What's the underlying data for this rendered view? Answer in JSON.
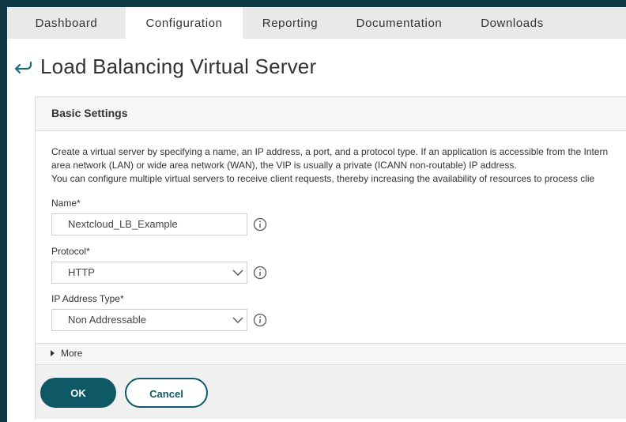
{
  "nav": {
    "tabs": [
      {
        "label": "Dashboard",
        "active": false
      },
      {
        "label": "Configuration",
        "active": true
      },
      {
        "label": "Reporting",
        "active": false
      },
      {
        "label": "Documentation",
        "active": false
      },
      {
        "label": "Downloads",
        "active": false
      }
    ]
  },
  "page": {
    "title": "Load Balancing Virtual Server",
    "back_icon": "back-arrow-icon"
  },
  "panel": {
    "title": "Basic Settings",
    "description": [
      "Create a virtual server by specifying a name, an IP address, a port, and a protocol type. If an application is accessible from the Intern",
      "area network (LAN) or wide area network (WAN), the VIP is usually a private (ICANN non-routable) IP address.",
      "You can configure multiple virtual servers to receive client requests, thereby increasing the availability of resources to process clie"
    ],
    "fields": {
      "name": {
        "label": "Name*",
        "value": "Nextcloud_LB_Example"
      },
      "protocol": {
        "label": "Protocol*",
        "value": "HTTP"
      },
      "ip_address_type": {
        "label": "IP Address Type*",
        "value": "Non Addressable"
      }
    },
    "more_label": "More"
  },
  "footer": {
    "ok_label": "OK",
    "cancel_label": "Cancel"
  },
  "colors": {
    "brand_dark": "#0f3a45",
    "button_primary": "#0f5966"
  }
}
